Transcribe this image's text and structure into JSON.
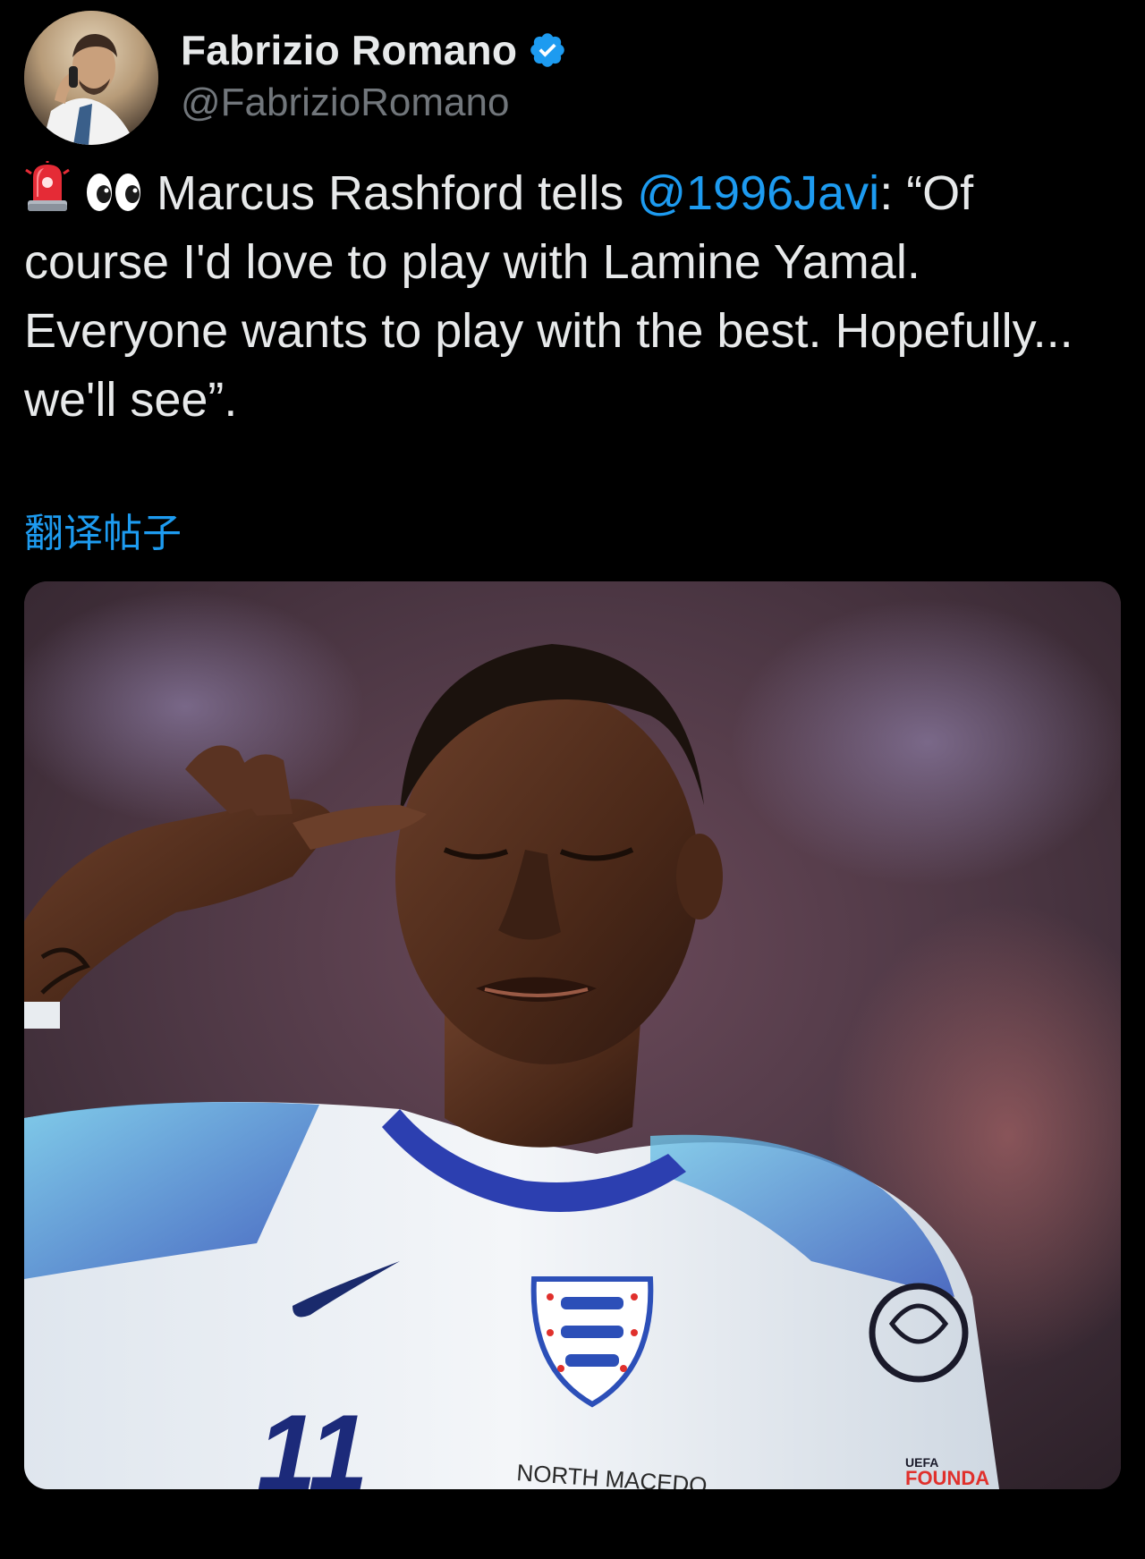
{
  "tweet": {
    "author": {
      "display_name": "Fabrizio Romano",
      "handle": "@FabrizioRomano",
      "verified_color": "#1d9bf0"
    },
    "text": {
      "emojis": [
        "police-light-emoji",
        "eyes-emoji"
      ],
      "lead": " Marcus Rashford tells ",
      "mention": "@1996Javi",
      "rest": ": “Of course I'd love to play with Lamine Yamal. Everyone wants to play with the best. Hopefully... we'll see”."
    },
    "translate_label": "翻译帖子",
    "media": {
      "kind": "photo",
      "jersey_number": "11",
      "jersey_text": "NORTH MACEDO",
      "badge_text_1": "UEFA",
      "badge_text_2": "FOUNDA"
    }
  },
  "colors": {
    "background": "#000000",
    "text_primary": "#e7e9ea",
    "text_secondary": "#71767b",
    "accent_link": "#1d9bf0"
  }
}
